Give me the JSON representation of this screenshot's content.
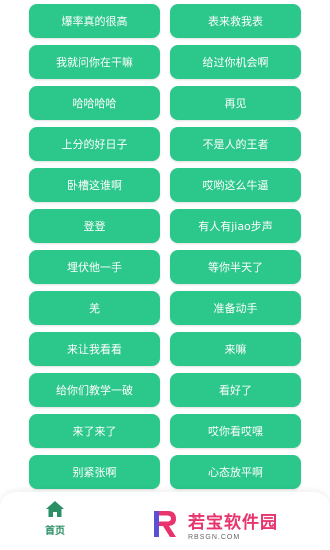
{
  "buttons": [
    [
      "爆率真的很高",
      "表来救我表"
    ],
    [
      "我就问你在干嘛",
      "给过你机会啊"
    ],
    [
      "哈哈哈哈",
      "再见"
    ],
    [
      "上分的好日子",
      "不是人的王者"
    ],
    [
      "卧槽这谁啊",
      "哎哟这么牛逼"
    ],
    [
      "登登",
      "有人有jiao步声"
    ],
    [
      "埋伏他一手",
      "等你半天了"
    ],
    [
      "羌",
      "准备动手"
    ],
    [
      "来让我看看",
      "来嘛"
    ],
    [
      "给你们教学一破",
      "看好了"
    ],
    [
      "来了来了",
      "哎你看哎嘿"
    ],
    [
      "别紧张啊",
      "心态放平啊"
    ]
  ],
  "bottom_nav": {
    "home_label": "首页",
    "home_icon": "home-icon"
  },
  "watermark": {
    "title": "若宝软件园",
    "subtitle": "RBSGN.COM"
  },
  "colors": {
    "button_bg": "#2cc78b",
    "nav_label": "#2a8f65",
    "watermark": "#e8336d"
  }
}
